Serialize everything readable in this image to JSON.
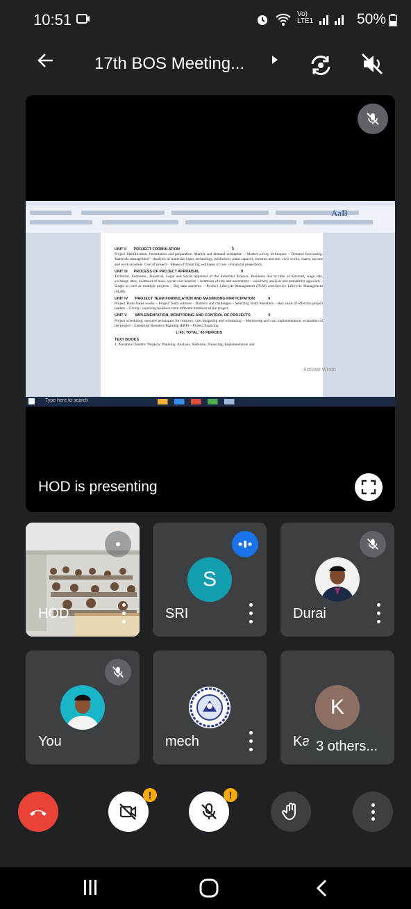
{
  "status_bar": {
    "time": "10:51",
    "battery": "50%"
  },
  "header": {
    "title": "17th BOS Meeting...",
    "back_icon": "arrow-back-icon",
    "switch_camera_icon": "switch-camera-icon",
    "speaker_icon": "speaker-off-icon"
  },
  "presentation": {
    "label": "HOD is presenting",
    "doc_lines": [
      {
        "heading": "UNIT II       PROJECT FORMULATION                                                  9"
      },
      {
        "text": "Project Identification, formulation and preparation. Market and demand estimation – Market survey techniques – Demand forecasting. Materials management – Analysis of materials input, technology, production, plant capacity, location and site, civil works, charts, layouts and work schedule. Cost of project – Means of financing, estimates of cost – Financial projections."
      },
      {
        "heading": "UNIT III      PROCESS OF PROJECT APPRAISAL                                        9"
      },
      {
        "text": "Technical, Economic, Financial, Legal and Social appraisal of the Industrial Projects. Problems due to time of discount, wage rate, exchange rates, treatment of taxes, social cost benefits – treatment of risk and uncertainty – sensitivity analysis and probability approach – Single as well as multiple projects – Big data analytics – Product Lifecycle Management (PLM) and Service Lifecycle Management (SLM)."
      },
      {
        "heading": "UNIT IV       PROJECT TEAM FORMULATION AND MAXIMIZING PARTICIPATION             9"
      },
      {
        "text": "Project Team frame works – Project Team cultures – Barriers and challenges – Selecting Team Members – Key skills of effective project leaders – Giving / receiving feedback from different members of the project."
      },
      {
        "heading": "UNIT V        IMPLEMENTATION, MONITORING AND CONTROL OF PROJECTS                 9"
      },
      {
        "text": "Project scheduling, network techniques for resource, cost budgeting and scheduling – Monitoring and cost implementation, evaluation of the project – Enterprise Resource Planning (ERP) – Project financing."
      },
      {
        "heading": "                                                           L:45; TOTAL: 45 PERIODS"
      },
      {
        "heading": "TEXT BOOKS"
      },
      {
        "text": "1.  Prasanna Chandra \"Projects: Planning, Analysis, Selection, Financing, Implementation and"
      }
    ],
    "taskbar_search": "Type here to search",
    "watermark": "Activate Windo"
  },
  "participants": [
    {
      "name": "HOD",
      "type": "video"
    },
    {
      "name": "SRI",
      "type": "initial",
      "initial": "S",
      "color": "#129eaf",
      "speaking": true
    },
    {
      "name": "Durai",
      "type": "photo",
      "muted": true
    },
    {
      "name": "You",
      "type": "photo",
      "muted": true
    },
    {
      "name": "mech",
      "type": "logo"
    },
    {
      "name": "Ka",
      "type": "initial",
      "initial": "K",
      "color": "#8d6e63",
      "others": "3 others..."
    }
  ],
  "controls": [
    {
      "name": "end-call",
      "color": "#ea4335"
    },
    {
      "name": "camera-off",
      "color": "#ffffff",
      "badge": "!"
    },
    {
      "name": "mic-off",
      "color": "#ffffff",
      "badge": "!"
    },
    {
      "name": "raise-hand",
      "color": "#3c4043"
    },
    {
      "name": "more-options",
      "color": "#3c4043"
    }
  ]
}
